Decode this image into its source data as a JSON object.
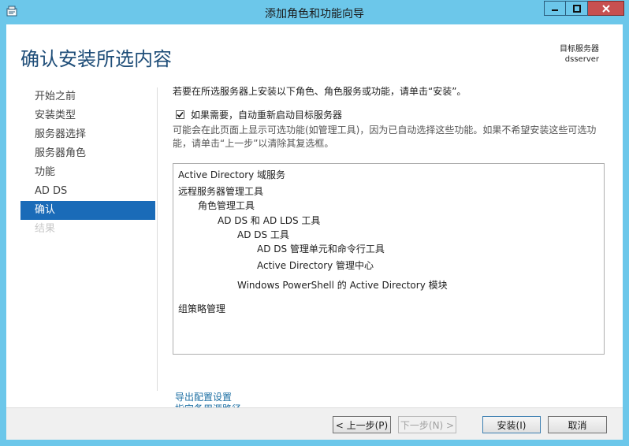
{
  "window": {
    "title": "添加角色和功能向导"
  },
  "header": {
    "page_title": "确认安装所选内容",
    "target_server_label": "目标服务器",
    "target_server_name": "dsserver"
  },
  "sidebar": {
    "items": [
      {
        "label": "开始之前",
        "state": "normal"
      },
      {
        "label": "安装类型",
        "state": "normal"
      },
      {
        "label": "服务器选择",
        "state": "normal"
      },
      {
        "label": "服务器角色",
        "state": "normal"
      },
      {
        "label": "功能",
        "state": "normal"
      },
      {
        "label": "AD DS",
        "state": "normal"
      },
      {
        "label": "确认",
        "state": "active"
      },
      {
        "label": "结果",
        "state": "disabled"
      }
    ]
  },
  "main": {
    "intro": "若要在所选服务器上安装以下角色、角色服务或功能，请单击“安装”。",
    "restart_checkbox": {
      "label": "如果需要，自动重新启动目标服务器",
      "checked": true
    },
    "note_line1": "可能会在此页面上显示可选功能(如管理工具)，因为已自动选择这些功能。如果不希望安装这些可选功",
    "note_line2": "能，请单击“上一步”以清除其复选框。",
    "features": [
      "Active Directory 域服务",
      "远程服务器管理工具",
      "角色管理工具",
      "AD DS 和 AD LDS 工具",
      "AD DS 工具",
      "AD DS 管理单元和命令行工具",
      "Active Directory 管理中心",
      "Windows PowerShell 的 Active Directory 模块",
      "组策略管理"
    ],
    "links": {
      "export": "导出配置设置",
      "alt_source": "指定备用源路径"
    }
  },
  "buttons": {
    "previous": "< 上一步(P)",
    "next": "下一步(N) >",
    "install": "安装(I)",
    "cancel": "取消"
  },
  "colors": {
    "titlebar": "#6cc7ea",
    "accent": "#1a6bb8",
    "page_title": "#1e4d78",
    "link": "#1d6fa3"
  }
}
